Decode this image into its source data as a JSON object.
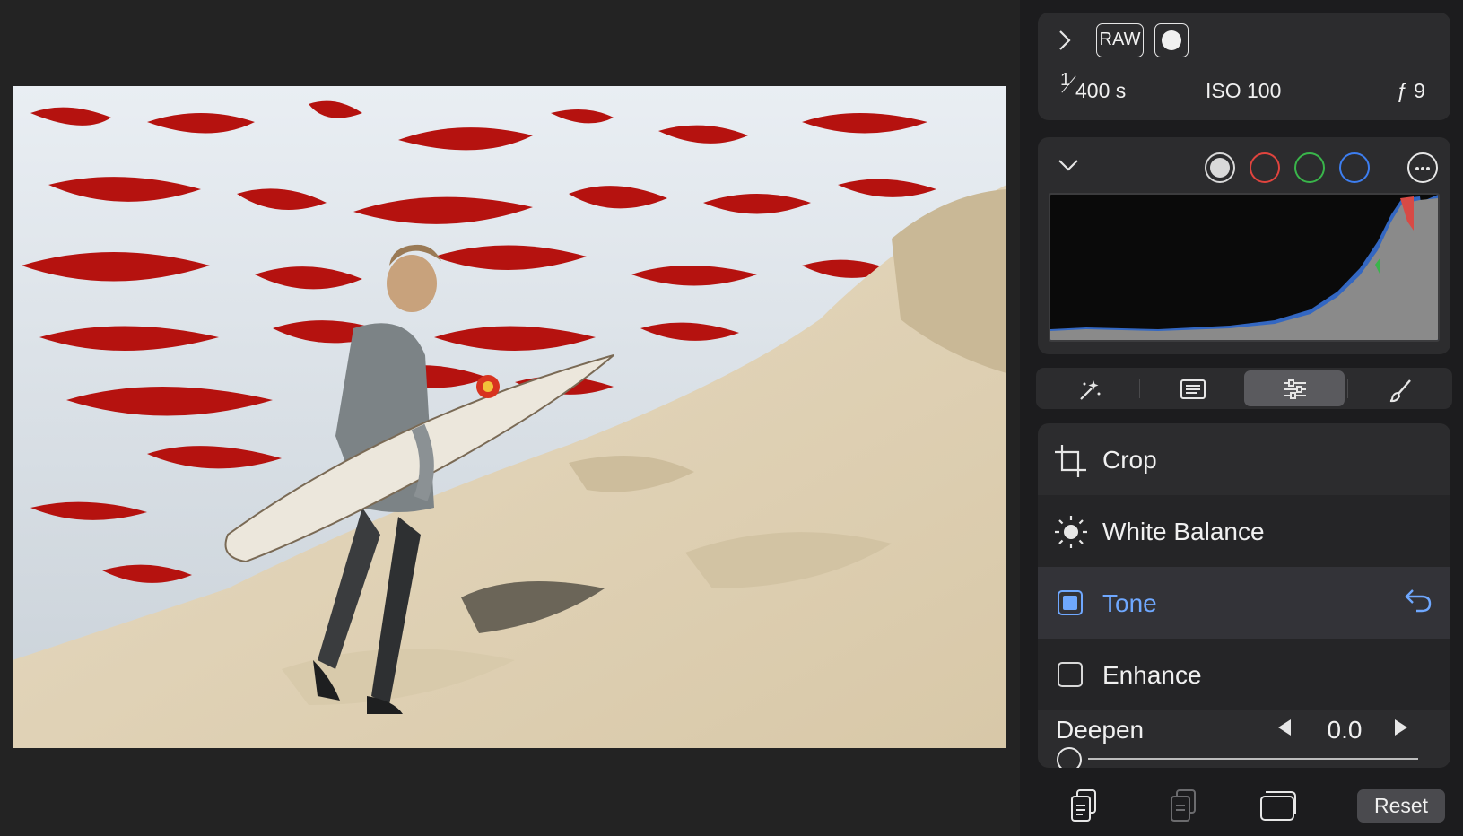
{
  "info": {
    "raw_badge": "RAW",
    "shutter_numerator": "1",
    "shutter_denominator": "400 s",
    "iso": "ISO 100",
    "aperture": "ƒ 9"
  },
  "histogram": {
    "channels": [
      {
        "name": "luminance-icon",
        "color": "#d9d9d9",
        "selected": true
      },
      {
        "name": "red-channel-icon",
        "color": "#e0443e"
      },
      {
        "name": "green-channel-icon",
        "color": "#39b54a"
      },
      {
        "name": "blue-channel-icon",
        "color": "#3d7ef0"
      }
    ]
  },
  "toolbar": {
    "tabs": [
      "magic-wand-icon",
      "metadata-icon",
      "adjustments-icon",
      "brush-icon"
    ],
    "active_tab": 2
  },
  "adjustments": {
    "crop_label": "Crop",
    "white_balance_label": "White Balance",
    "tone_label": "Tone",
    "enhance_label": "Enhance",
    "deepen_label": "Deepen",
    "deepen_value": "0.0"
  },
  "bottom": {
    "reset_label": "Reset"
  },
  "colors": {
    "accent": "#6fa8ff",
    "clip_overlay": "#b5120f"
  }
}
